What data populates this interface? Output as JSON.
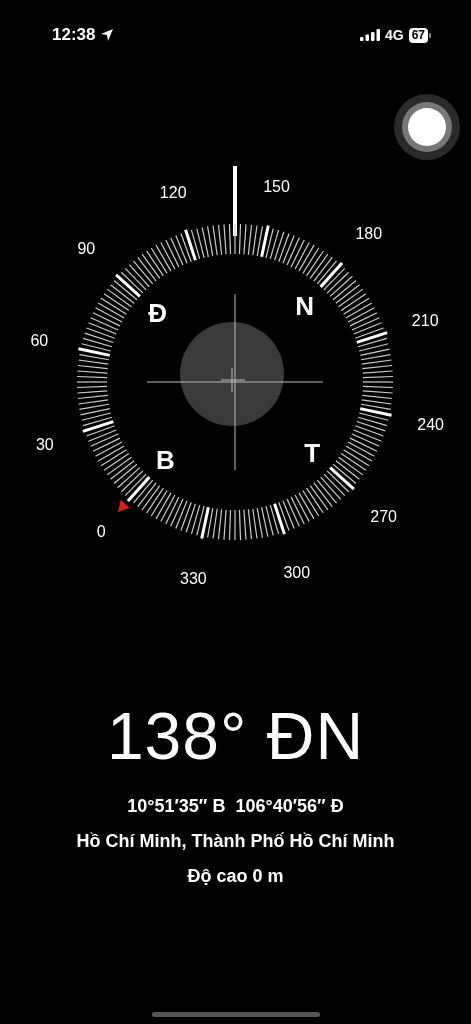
{
  "status_bar": {
    "time": "12:38",
    "network": "4G",
    "battery": "67"
  },
  "dial": {
    "degree_labels": [
      "0",
      "30",
      "60",
      "90",
      "120",
      "150",
      "180",
      "210",
      "240",
      "270",
      "300",
      "330"
    ],
    "cardinals": [
      "Đ",
      "N",
      "B",
      "T"
    ]
  },
  "heading": "138° ĐN",
  "coordinates": "10°51′35″ B  106°40′56″ Đ",
  "location": "Hồ Chí Minh, Thành Phố Hồ Chí Minh",
  "altitude": "Độ cao 0 m"
}
